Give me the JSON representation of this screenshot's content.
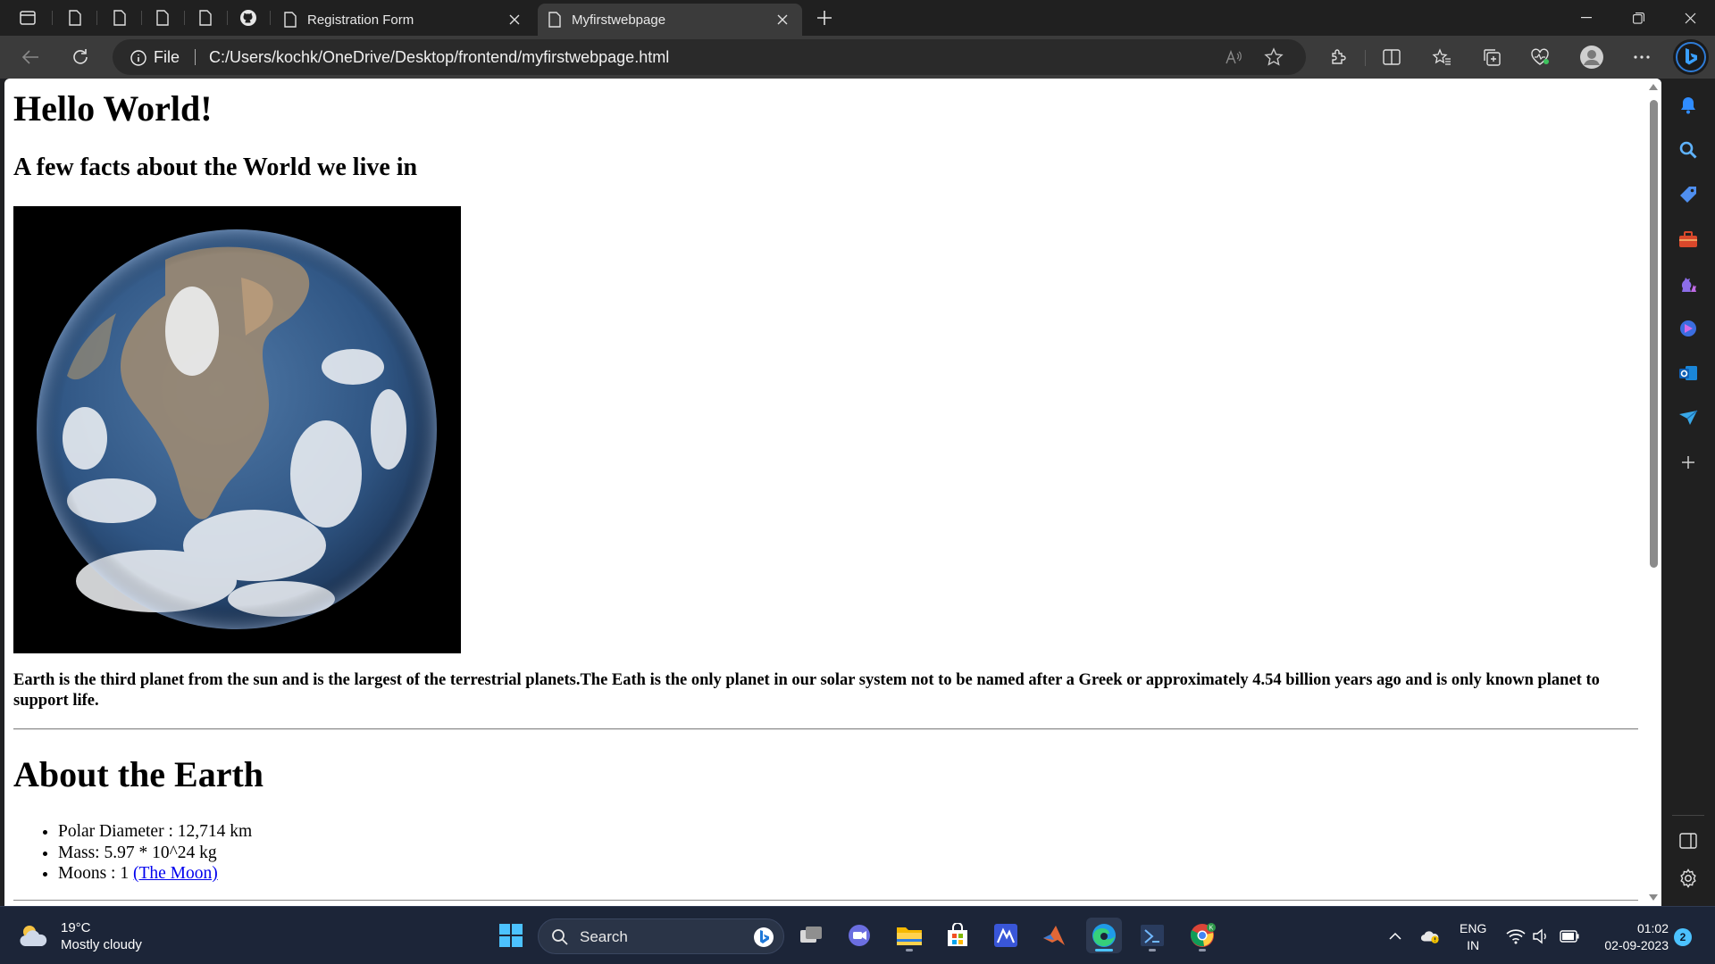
{
  "browser": {
    "tabs": [
      {
        "title": "Registration Form",
        "active": false
      },
      {
        "title": "Myfirstwebpage",
        "active": true
      }
    ],
    "address": {
      "scheme_label": "File",
      "url": "C:/Users/kochk/OneDrive/Desktop/frontend/myfirstwebpage.html"
    },
    "sidebar_icons": [
      "copilot-icon",
      "bell-icon",
      "search-icon",
      "tag-icon",
      "toolbox-icon",
      "chess-icon",
      "game-icon",
      "outlook-icon",
      "send-icon",
      "add-icon",
      "sidebar-toggle-icon",
      "settings-icon"
    ]
  },
  "page": {
    "heading": "Hello World!",
    "subheading": "A few facts about the World we live in",
    "image_alt": "Earth",
    "description": "Earth is the third planet from the sun and is the largest of the terrestrial planets.The Eath is the only planet in our solar system not to be named after a Greek or approximately 4.54 billion years ago and is only known planet to support life.",
    "about_heading": "About the Earth",
    "facts": [
      {
        "text": "Polar Diameter : 12,714 km"
      },
      {
        "text": "Mass: 5.97 * 10^24 kg"
      },
      {
        "text": "Moons : 1 ",
        "link": "(The Moon)"
      }
    ]
  },
  "taskbar": {
    "weather": {
      "temp": "19°C",
      "condition": "Mostly cloudy"
    },
    "search_placeholder": "Search",
    "lang": {
      "line1": "ENG",
      "line2": "IN"
    },
    "clock": {
      "time": "01:02",
      "date": "02-09-2023"
    },
    "notifications": "2"
  },
  "colors": {
    "accent": "#4cc2ff",
    "link": "#0000ee",
    "chrome_dark": "#202020",
    "toolbar": "#3b3b3b"
  }
}
